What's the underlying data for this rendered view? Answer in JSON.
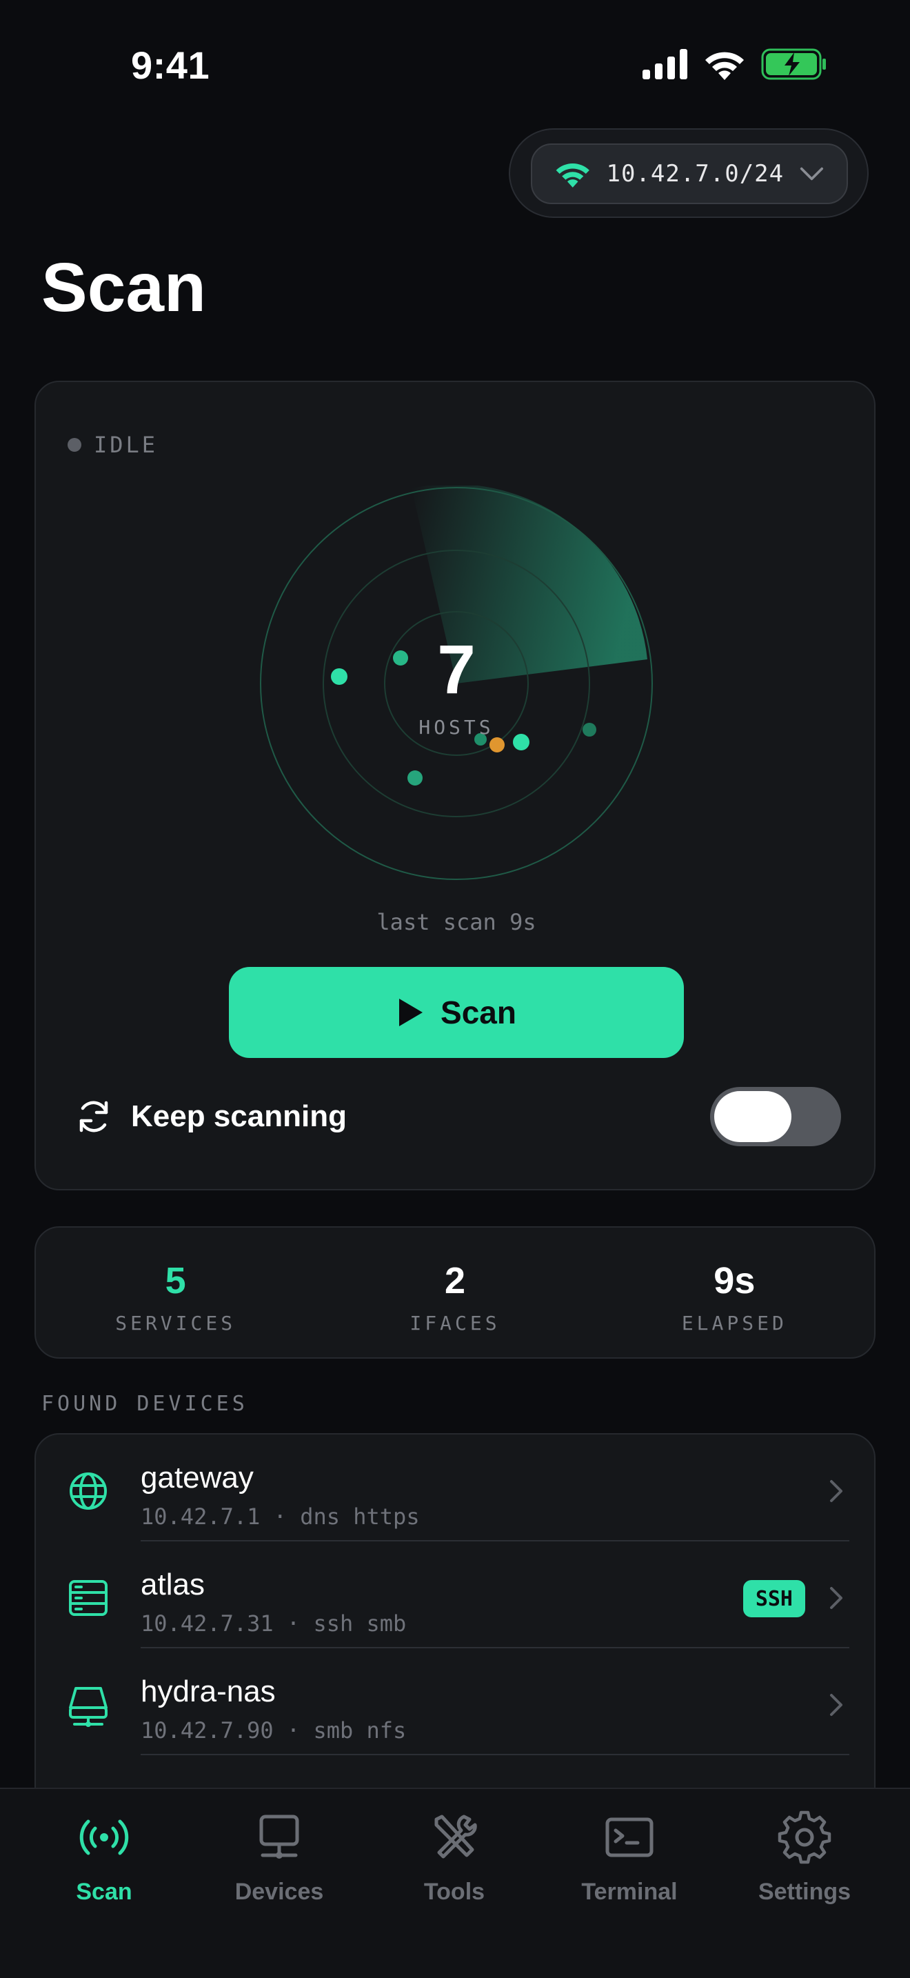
{
  "status_bar": {
    "time": "9:41",
    "icons": [
      "signal-icon",
      "wifi-icon",
      "battery-charging-icon"
    ]
  },
  "network": {
    "cidr": "10.42.7.0/24",
    "icon": "wifi-icon"
  },
  "page": {
    "title": "Scan"
  },
  "scan": {
    "state": "IDLE",
    "host_count": "7",
    "host_label": "HOSTS",
    "last_scan": "last scan 9s",
    "button_label": "Scan",
    "keep_scanning_label": "Keep scanning",
    "keep_scanning_on": false
  },
  "stats": [
    {
      "value": "5",
      "label": "SERVICES",
      "color": "#2fe0a8"
    },
    {
      "value": "2",
      "label": "IFACES",
      "color": "#ffffff"
    },
    {
      "value": "9s",
      "label": "ELAPSED",
      "color": "#ffffff"
    }
  ],
  "devices_section": {
    "label": "FOUND DEVICES"
  },
  "devices": [
    {
      "name": "gateway",
      "meta": "10.42.7.1 · dns https",
      "icon": "globe-icon",
      "badge": ""
    },
    {
      "name": "atlas",
      "meta": "10.42.7.31 · ssh smb",
      "icon": "server-icon",
      "badge": "SSH"
    },
    {
      "name": "hydra-nas",
      "meta": "10.42.7.90 · smb nfs",
      "icon": "nas-drive-icon",
      "badge": ""
    }
  ],
  "tabs": [
    {
      "label": "Scan",
      "icon": "radar-antenna-icon",
      "active": true
    },
    {
      "label": "Devices",
      "icon": "desktop-icon",
      "active": false
    },
    {
      "label": "Tools",
      "icon": "tools-icon",
      "active": false
    },
    {
      "label": "Terminal",
      "icon": "terminal-icon",
      "active": false
    },
    {
      "label": "Settings",
      "icon": "gear-icon",
      "active": false
    }
  ],
  "colors": {
    "accent": "#2fe0a8",
    "background": "#0b0c0f",
    "card": "#15171a",
    "warning_dot": "#e0962f"
  }
}
